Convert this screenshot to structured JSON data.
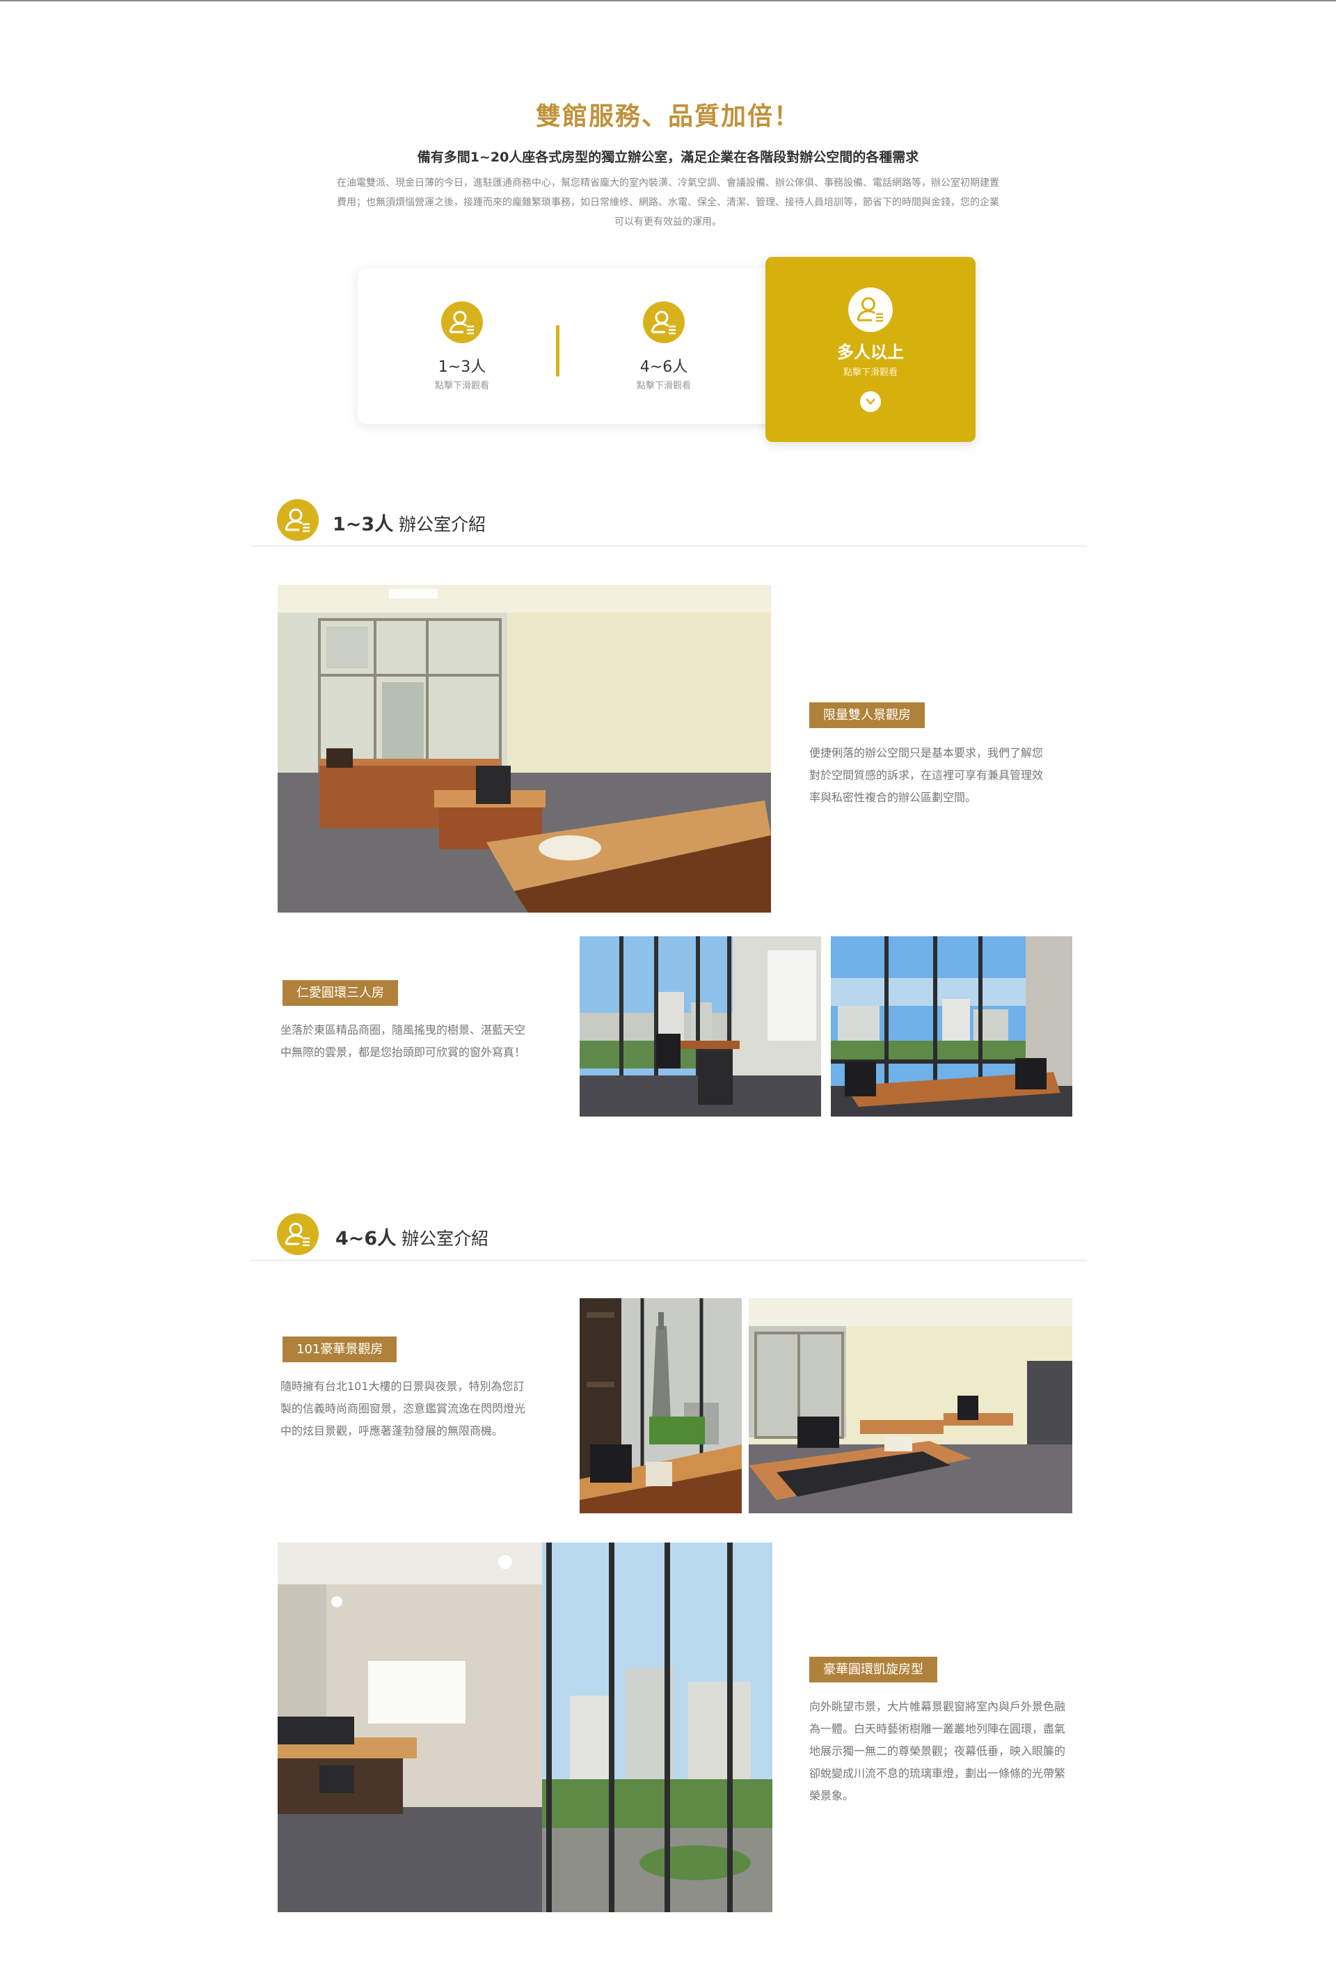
{
  "intro": {
    "title": "雙館服務、品質加倍！",
    "subtitle": "備有多間1~20人座各式房型的獨立辦公室，滿足企業在各階段對辦公空間的各種需求",
    "description": "在油電雙派、現金日薄的今日，進駐匯通商務中心，幫您精省龐大的室內裝潢、冷氣空調、會議設備、辦公傢俱、事務設備、電話網路等，辦公室初期建置費用；也無須煩惱營運之後，接踵而來的龐雜繁瑣事務，如日常維修、網路、水電、保全、清潔、管理、接待人員培訓等，節省下的時間與金錢，您的企業可以有更有效益的運用。"
  },
  "selector": {
    "items": [
      {
        "label": "1~3人",
        "hint": "點擊下滑觀看"
      },
      {
        "label": "4~6人",
        "hint": "點擊下滑觀看"
      },
      {
        "label": "多人以上",
        "hint": "點擊下滑觀看"
      }
    ]
  },
  "sections": [
    {
      "title_bold": "1~3人",
      "title_rest": " 辦公室介紹",
      "rooms": [
        {
          "badge": "限量雙人景觀房",
          "text": "便捷俐落的辦公空間只是基本要求，我們了解您對於空間質感的訴求，在這裡可享有兼具管理效率與私密性複合的辦公區劃空間。"
        },
        {
          "badge": "仁愛圓環三人房",
          "text": "坐落於東區精品商圈，隨風搖曳的樹景、湛藍天空中無際的雲景，都是您抬頭即可欣賞的窗外寫真！"
        }
      ]
    },
    {
      "title_bold": "4~6人",
      "title_rest": " 辦公室介紹",
      "rooms": [
        {
          "badge": "101豪華景觀房",
          "text": "隨時擁有台北101大樓的日景與夜景，特別為您訂製的信義時尚商圈窗景，恣意鑑賞流逸在閃閃燈光中的炫目景觀，呼應著蓬勃發展的無限商機。"
        },
        {
          "badge": "豪華圓環凱旋房型",
          "text": "向外眺望市景，大片帷幕景觀窗將室內與戶外景色融為一體。白天時藝術樹雕一叢叢地列陣在圓環，盡氣地展示獨一無二的尊榮景觀；夜幕低垂，映入眼簾的卻蛻變成川流不息的琉璃車燈，劃出一條條的光帶繁榮景象。"
        }
      ]
    }
  ],
  "colors": {
    "accent_gold": "#d8b21d",
    "title_gold": "#c0923a",
    "badge_brown": "#b0813a"
  },
  "icons": {
    "person": "person-list-icon",
    "chevron": "chevron-down-icon"
  }
}
